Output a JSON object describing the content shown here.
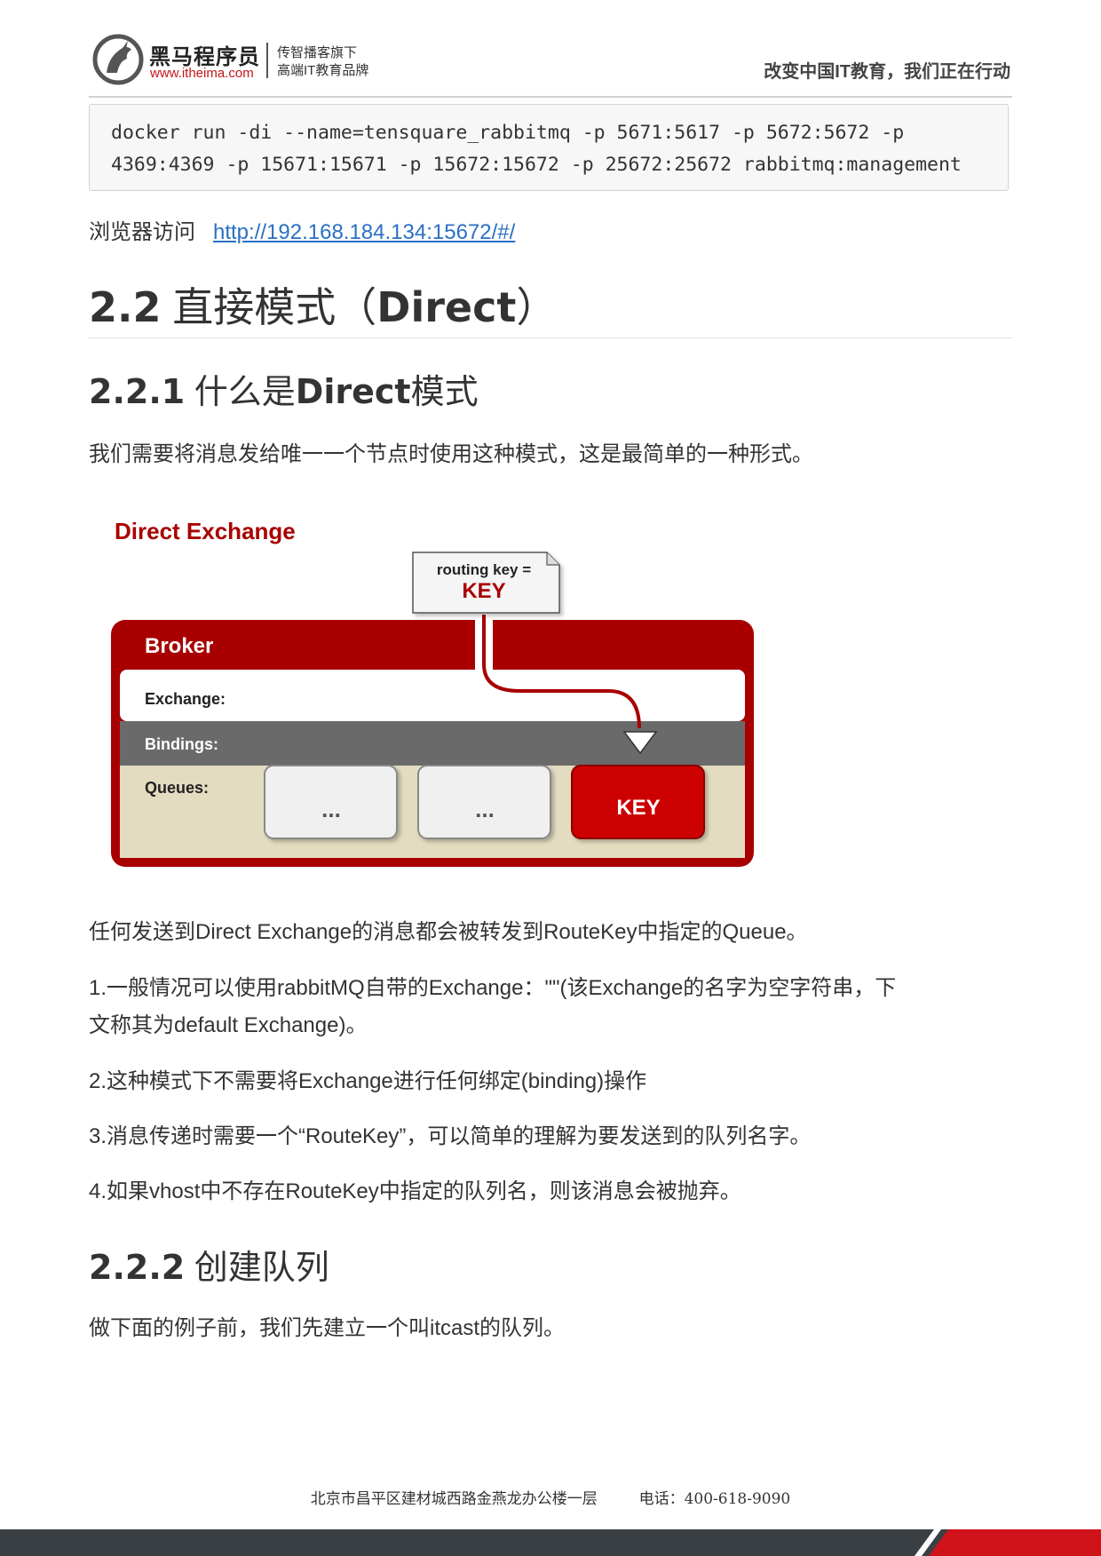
{
  "header": {
    "brand_name": "黑马程序员",
    "brand_url": "www.itheima.com",
    "sub_line1": "传智播客旗下",
    "sub_line2": "高端IT教育品牌",
    "slogan": "改变中国IT教育，我们正在行动"
  },
  "code": {
    "line1": "docker run -di --name=tensquare_rabbitmq -p 5671:5617 -p 5672:5672 -p",
    "line2": "4369:4369 -p 15671:15671 -p 15672:15672 -p 25672:25672 rabbitmq:management"
  },
  "browser": {
    "label": "浏览器访问",
    "url": "http://192.168.184.134:15672/#/"
  },
  "section": {
    "number": "2.2",
    "title_prefix": "直接模式（",
    "title_bold": "Direct",
    "title_suffix": "）"
  },
  "sub1": {
    "number": "2.2.1",
    "title_prefix": "什么是",
    "title_bold": "Direct",
    "title_suffix": "模式"
  },
  "intro": "我们需要将消息发给唯一一个节点时使用这种模式，这是最简单的一种形式。",
  "diagram": {
    "title": "Direct Exchange",
    "routing_label": "routing key =",
    "routing_value": "KEY",
    "broker_label": "Broker",
    "exchange_label": "Exchange:",
    "bindings_label": "Bindings:",
    "queues_label": "Queues:",
    "queue1": "...",
    "queue2": "...",
    "queue3": "KEY",
    "colors": {
      "red": "#a80000",
      "bright_red": "#cc0000",
      "gray_band": "#6a6a6a",
      "beige": "#e3dcc0"
    }
  },
  "body": {
    "p1": "任何发送到Direct Exchange的消息都会被转发到RouteKey中指定的Queue。",
    "p2_line1": "1.一般情况可以使用rabbitMQ自带的Exchange：\"\"(该Exchange的名字为空字符串，下",
    "p2_line2": "文称其为default Exchange)。",
    "p3": "2.这种模式下不需要将Exchange进行任何绑定(binding)操作",
    "p4": "3.消息传递时需要一个“RouteKey”，可以简单的理解为要发送到的队列名字。",
    "p5": "4.如果vhost中不存在RouteKey中指定的队列名，则该消息会被抛弃。"
  },
  "sub2": {
    "number": "2.2.2",
    "title": "创建队列"
  },
  "sub2_text": "做下面的例子前，我们先建立一个叫itcast的队列。",
  "footer": {
    "address": "北京市昌平区建材城西路金燕龙办公楼一层",
    "phone": "电话：400-618-9090"
  }
}
